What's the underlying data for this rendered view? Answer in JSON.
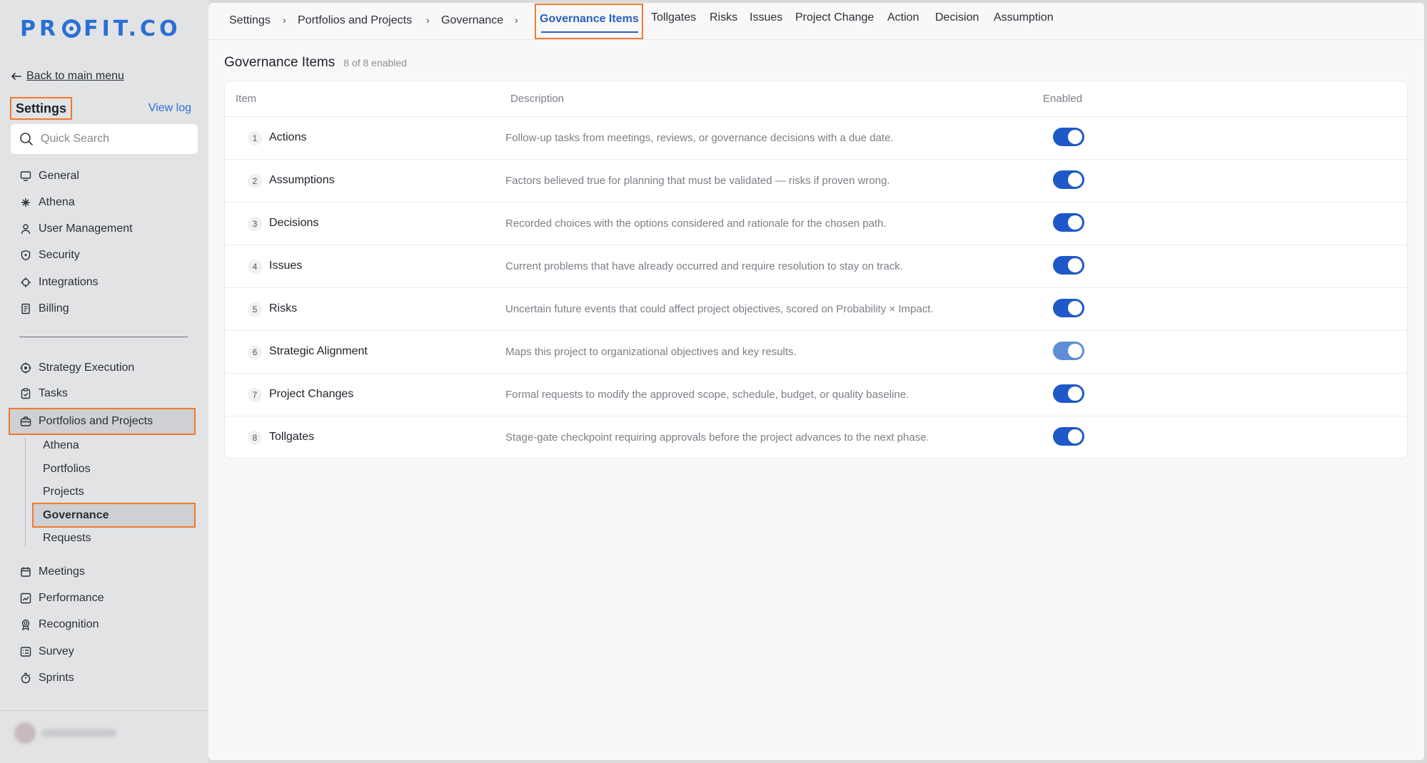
{
  "brand": {
    "logo_left": "PR",
    "logo_right": "FIT.CO",
    "accent": "#2a6fd6",
    "highlight": "#f07a2b"
  },
  "sidebar": {
    "back_label": "Back to main menu",
    "settings_title": "Settings",
    "view_log": "View log",
    "search_placeholder": "Quick Search",
    "group1": [
      {
        "label": "General",
        "icon": "monitor-icon"
      },
      {
        "label": "Athena",
        "icon": "sparkle-icon"
      },
      {
        "label": "User Management",
        "icon": "user-icon"
      },
      {
        "label": "Security",
        "icon": "shield-icon"
      },
      {
        "label": "Integrations",
        "icon": "plug-icon"
      },
      {
        "label": "Billing",
        "icon": "receipt-icon"
      }
    ],
    "group2": [
      {
        "label": "Strategy Execution",
        "icon": "target-icon"
      },
      {
        "label": "Tasks",
        "icon": "clipboard-icon"
      }
    ],
    "portfolios": {
      "label": "Portfolios and Projects",
      "icon": "briefcase-icon"
    },
    "sub_items": [
      "Athena",
      "Portfolios",
      "Projects",
      "Governance",
      "Requests"
    ],
    "group3": [
      {
        "label": "Meetings",
        "icon": "calendar-icon"
      },
      {
        "label": "Performance",
        "icon": "chart-icon"
      },
      {
        "label": "Recognition",
        "icon": "award-icon"
      },
      {
        "label": "Survey",
        "icon": "list-icon"
      },
      {
        "label": "Sprints",
        "icon": "timer-icon"
      }
    ]
  },
  "breadcrumb": [
    "Settings",
    "Portfolios and Projects",
    "Governance"
  ],
  "breadcrumb_sep": "›",
  "tabs": {
    "active": "Governance Items",
    "others": [
      "Tollgates",
      "Risks",
      "Issues",
      "Project Change",
      "Action",
      "Decision",
      "Assumption"
    ]
  },
  "page": {
    "title": "Governance Items",
    "count": "8 of 8 enabled"
  },
  "table": {
    "headers": {
      "item": "Item",
      "description": "Description",
      "enabled": "Enabled"
    },
    "rows": [
      {
        "num": "1",
        "name": "Actions",
        "desc": "Follow-up tasks from meetings, reviews, or governance decisions with a due date.",
        "enabled": true
      },
      {
        "num": "2",
        "name": "Assumptions",
        "desc": "Factors believed true for planning that must be validated — risks if proven wrong.",
        "enabled": true
      },
      {
        "num": "3",
        "name": "Decisions",
        "desc": "Recorded choices with the options considered and rationale for the chosen path.",
        "enabled": true
      },
      {
        "num": "4",
        "name": "Issues",
        "desc": "Current problems that have already occurred and require resolution to stay on track.",
        "enabled": true
      },
      {
        "num": "5",
        "name": "Risks",
        "desc": "Uncertain future events that could affect project objectives, scored on Probability × Impact.",
        "enabled": true
      },
      {
        "num": "6",
        "name": "Strategic Alignment",
        "desc": "Maps this project to organizational objectives and key results.",
        "enabled": true
      },
      {
        "num": "7",
        "name": "Project Changes",
        "desc": "Formal requests to modify the approved scope, schedule, budget, or quality baseline.",
        "enabled": true
      },
      {
        "num": "8",
        "name": "Tollgates",
        "desc": "Stage-gate checkpoint requiring approvals before the project advances to the next phase.",
        "enabled": true
      }
    ]
  }
}
